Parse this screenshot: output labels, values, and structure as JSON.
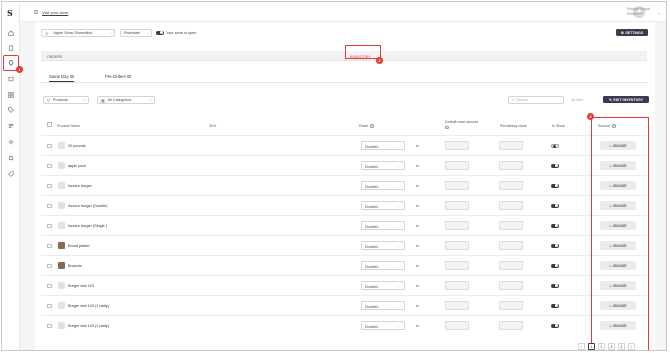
{
  "app": {
    "logo": "S",
    "visit_link": "Visit your store"
  },
  "user": {
    "name": "Kitchen Yogurt",
    "sub": "Riverdale"
  },
  "store": {
    "location_select": "Apple Store Shoreditch",
    "area_select": "Riverdale",
    "open_status": "Your store is open",
    "settings_label": "SETTINGS"
  },
  "tabs": {
    "orders": "ORDERS",
    "inventory": "INVENTORY"
  },
  "subtabs": {
    "same_day": "Same Day",
    "pre_orders": "Pre-Orders"
  },
  "filters": {
    "products": "Products",
    "categories": "All Categories",
    "search_placeholder": "Search",
    "filter_label": "All filter",
    "edit_inventory": "EDIT INVENTORY"
  },
  "columns": {
    "product_name": "Product Name",
    "sku": "SKU",
    "reset": "Reset",
    "default_reset": "Default reset amount",
    "remaining": "Remaining stock",
    "in_stock": "In Stock",
    "snooze": "Snooze"
  },
  "products": [
    {
      "name": "20 pounds",
      "reset": "Disabled",
      "to": "to",
      "in_stock": false,
      "snooze": "SNOOZE"
    },
    {
      "name": "apple juice",
      "reset": "Disabled",
      "to": "to",
      "in_stock": true,
      "snooze": "SNOOZE"
    },
    {
      "name": "Azzaro burger",
      "reset": "Disabled",
      "to": "to",
      "in_stock": true,
      "snooze": "SNOOZE"
    },
    {
      "name": "Azzaro burger (Double)",
      "reset": "Disabled",
      "to": "to",
      "in_stock": true,
      "snooze": "SNOOZE"
    },
    {
      "name": "Azzaro burger (Single )",
      "reset": "Disabled",
      "to": "to",
      "in_stock": true,
      "snooze": "SNOOZE"
    },
    {
      "name": "Board platter",
      "reset": "Disabled",
      "to": "to",
      "in_stock": true,
      "snooze": "SNOOZE"
    },
    {
      "name": "Brownie",
      "reset": "Disabled",
      "to": "to",
      "in_stock": true,
      "snooze": "SNOOZE"
    },
    {
      "name": "Burger test 103",
      "reset": "Disabled",
      "to": "to",
      "in_stock": true,
      "snooze": "SNOOZE"
    },
    {
      "name": "Burger test 103 (1 patty)",
      "reset": "Disabled",
      "to": "to",
      "in_stock": true,
      "snooze": "SNOOZE"
    },
    {
      "name": "Burger test 103 (1 patty)",
      "reset": "Disabled",
      "to": "to",
      "in_stock": true,
      "snooze": "SNOOZE"
    }
  ],
  "pagination": [
    "‹",
    "1",
    "2",
    "3",
    "4",
    "›"
  ],
  "annotations": [
    "1",
    "2",
    "3"
  ],
  "colors": {
    "accent": "#3b3b4f",
    "highlight": "#e53935"
  }
}
